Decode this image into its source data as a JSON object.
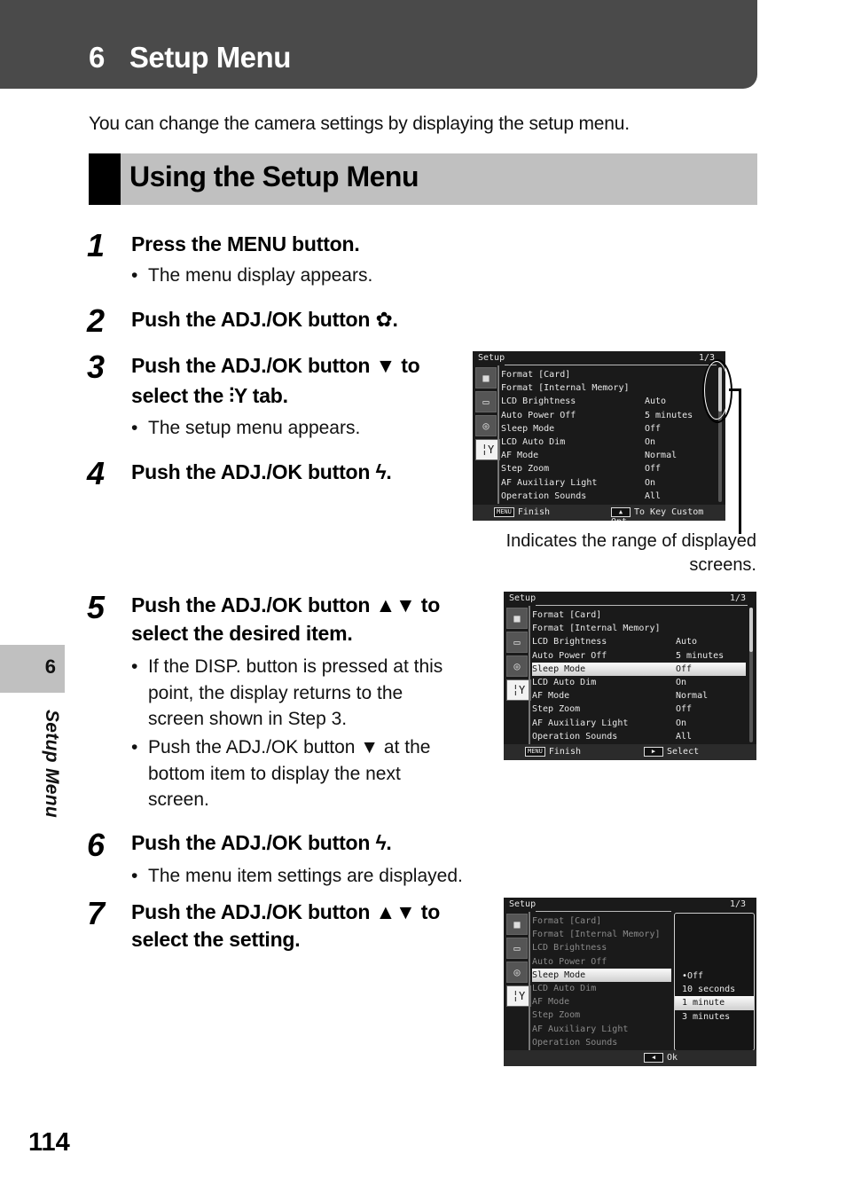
{
  "chapter": {
    "number": "6",
    "title": "Setup Menu"
  },
  "intro": "You can change the camera settings by displaying the setup menu.",
  "section_title": "Using the Setup Menu",
  "side_tab": {
    "number": "6",
    "label": "Setup Menu"
  },
  "page_number": "114",
  "glyphs": {
    "macro": "✿",
    "down": "▼",
    "updown": "▲▼",
    "setup_tab": "╎Y",
    "flash": "ϟ",
    "bullet": "•"
  },
  "steps": [
    {
      "num": "1",
      "lines": [
        "Press the MENU button."
      ],
      "bullets": [
        "The menu display appears."
      ]
    },
    {
      "num": "2",
      "lines": [
        "Push the ADJ./OK button ✿."
      ],
      "bullets": []
    },
    {
      "num": "3",
      "lines": [
        "Push the ADJ./OK button ▼ to",
        "select the ⫶Y tab."
      ],
      "bullets": [
        "The setup menu appears."
      ]
    },
    {
      "num": "4",
      "lines": [
        "Push the ADJ./OK button ϟ."
      ],
      "bullets": []
    },
    {
      "num": "5",
      "lines": [
        "Push the ADJ./OK button ▲▼ to",
        "select the desired item."
      ],
      "bullets": [
        [
          "If the DISP. button is pressed at this",
          "point, the display returns to the",
          "screen shown in Step 3."
        ],
        [
          "Push the ADJ./OK button ▼ at the",
          "bottom item to display the next",
          "screen."
        ]
      ]
    },
    {
      "num": "6",
      "lines": [
        "Push the ADJ./OK button ϟ."
      ],
      "bullets": [
        "The menu item settings are displayed."
      ]
    },
    {
      "num": "7",
      "lines": [
        "Push the ADJ./OK button ▲▼ to",
        "select the setting."
      ],
      "bullets": []
    }
  ],
  "callout": {
    "line1": "Indicates the range of displayed",
    "line2": "screens."
  },
  "screens": [
    {
      "title": "Setup",
      "page": "1/3",
      "tabs": [
        "camera-icon",
        "movie-icon",
        "playback-icon",
        "setup-icon"
      ],
      "items": [
        {
          "label": "Format [Card]",
          "value": ""
        },
        {
          "label": "Format [Internal Memory]",
          "value": ""
        },
        {
          "label": "LCD Brightness",
          "value": "Auto"
        },
        {
          "label": "Auto Power Off",
          "value": "5 minutes"
        },
        {
          "label": "Sleep Mode",
          "value": "Off"
        },
        {
          "label": "LCD Auto Dim",
          "value": "On"
        },
        {
          "label": "AF Mode",
          "value": "Normal"
        },
        {
          "label": "Step Zoom",
          "value": "Off"
        },
        {
          "label": "AF Auxiliary Light",
          "value": "On"
        },
        {
          "label": "Operation Sounds",
          "value": "All"
        }
      ],
      "footer_left_key": "MENU",
      "footer_left": "Finish",
      "footer_right_key": "▲",
      "footer_right": "To Key Custom Opt."
    },
    {
      "title": "Setup",
      "page": "1/3",
      "selected_item": "Sleep Mode",
      "items": [
        {
          "label": "Format [Card]",
          "value": ""
        },
        {
          "label": "Format [Internal Memory]",
          "value": ""
        },
        {
          "label": "LCD Brightness",
          "value": "Auto"
        },
        {
          "label": "Auto Power Off",
          "value": "5 minutes"
        },
        {
          "label": "Sleep Mode",
          "value": "Off"
        },
        {
          "label": "LCD Auto Dim",
          "value": "On"
        },
        {
          "label": "AF Mode",
          "value": "Normal"
        },
        {
          "label": "Step Zoom",
          "value": "Off"
        },
        {
          "label": "AF Auxiliary Light",
          "value": "On"
        },
        {
          "label": "Operation Sounds",
          "value": "All"
        }
      ],
      "footer_left_key": "MENU",
      "footer_left": "Finish",
      "footer_right_key": "▶",
      "footer_right": "Select"
    },
    {
      "title": "Setup",
      "page": "1/3",
      "selected_item": "Sleep Mode",
      "items": [
        {
          "label": "Format [Card]"
        },
        {
          "label": "Format [Internal Memory]"
        },
        {
          "label": "LCD Brightness"
        },
        {
          "label": "Auto Power Off"
        },
        {
          "label": "Sleep Mode"
        },
        {
          "label": "LCD Auto Dim"
        },
        {
          "label": "AF Mode"
        },
        {
          "label": "Step Zoom"
        },
        {
          "label": "AF Auxiliary Light"
        },
        {
          "label": "Operation Sounds"
        }
      ],
      "options": [
        "•Off",
        "10 seconds",
        "1 minute",
        "3 minutes"
      ],
      "current_option": "Off",
      "highlighted_option": "1 minute",
      "footer_right_key": "◀",
      "footer_right": "Ok"
    }
  ]
}
